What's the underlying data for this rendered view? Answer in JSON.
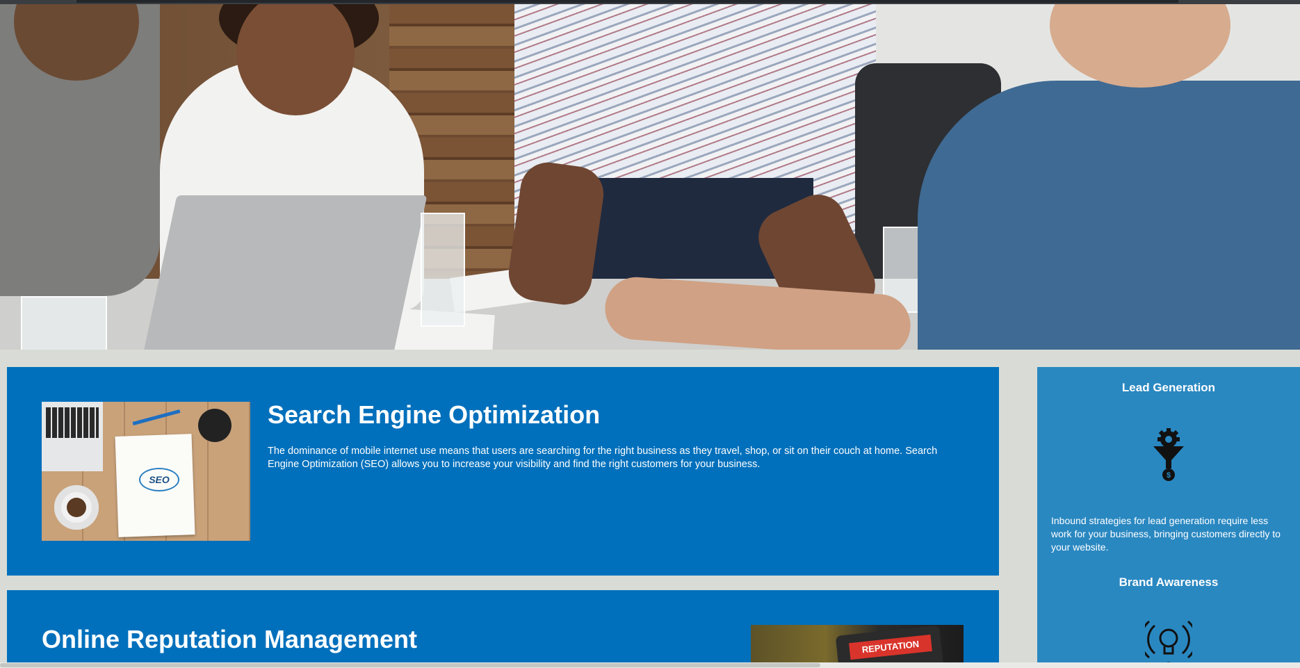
{
  "hero": {
    "alt": "business team meeting around a laptop"
  },
  "services": [
    {
      "title": "Search Engine Optimization",
      "description": "The dominance of mobile internet use means that users are searching for the right business as they travel, shop, or sit on their couch at home. Search Engine Optimization (SEO) allows you to increase your visibility and find the right customers for your business.",
      "image_label": "SEO"
    },
    {
      "title": "Online Reputation Management",
      "image_label": "REPUTATION"
    }
  ],
  "sidebar": {
    "items": [
      {
        "title": "Lead Generation",
        "icon": "lead-generation-funnel-icon",
        "text": "Inbound strategies for lead generation require less work for your business, bringing customers directly to your website."
      },
      {
        "title": "Brand Awareness",
        "icon": "brand-awareness-lightbulb-icon"
      }
    ]
  },
  "colors": {
    "card_blue": "#0170bc",
    "sidebar_blue": "#2a88c1",
    "page_background": "#d9dcd6"
  }
}
